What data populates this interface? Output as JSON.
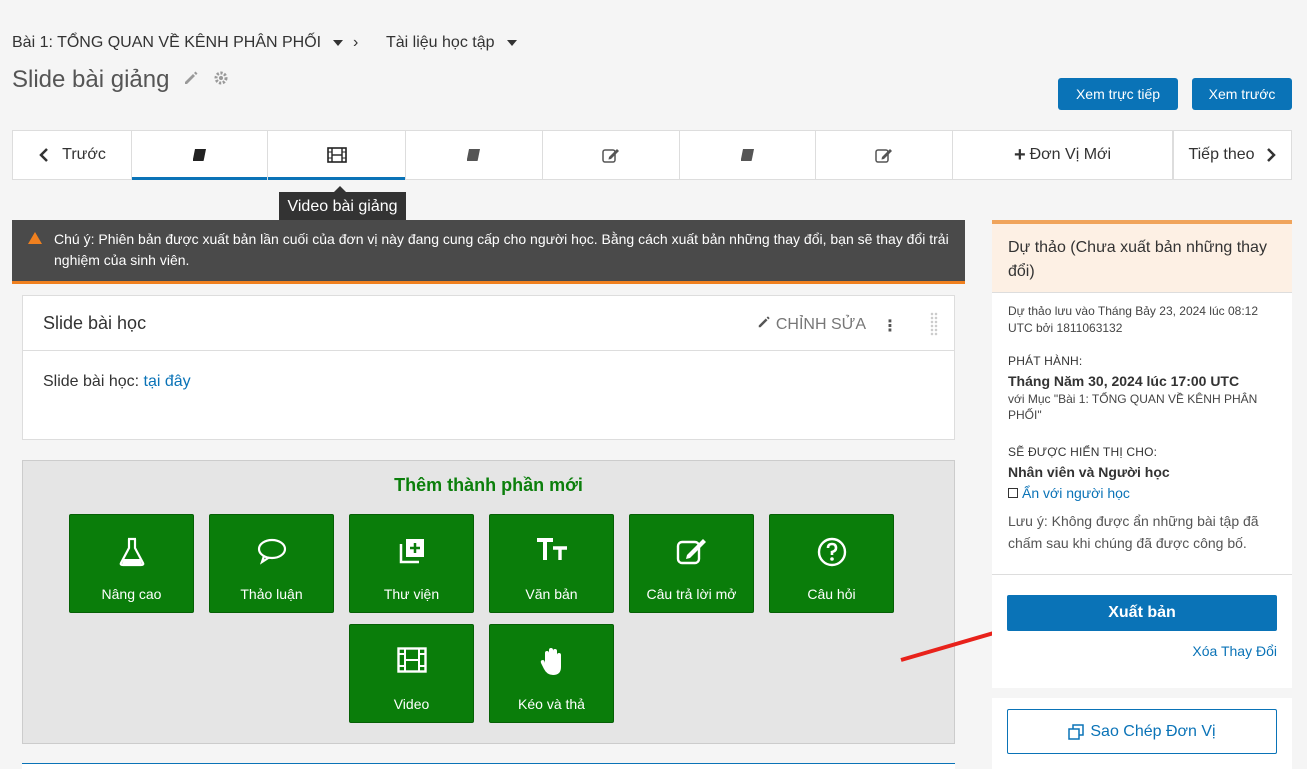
{
  "breadcrumb": {
    "section": "Bài 1: TỔNG QUAN VỀ KÊNH PHÂN PHỐI",
    "separator": "›",
    "subsection": "Tài liệu học tập"
  },
  "page": {
    "title": "Slide bài giảng"
  },
  "header_buttons": {
    "view_live": "Xem trực tiếp",
    "preview": "Xem trước"
  },
  "unit_nav": {
    "prev": "Trước",
    "new_unit": "Đơn Vị Mới",
    "next": "Tiếp theo",
    "units": [
      "book-icon",
      "film-icon",
      "book-icon",
      "edit-icon",
      "book-icon",
      "edit-icon"
    ],
    "tooltip": "Video bài giảng"
  },
  "warning": {
    "text": "Chú ý: Phiên bản được xuất bản lần cuối của đơn vị này đang cung cấp cho người học. Bằng cách xuất bản những thay đổi, bạn sẽ thay đổi trải nghiệm của sinh viên."
  },
  "component": {
    "title": "Slide bài học",
    "edit_label": "CHỈNH SỬA",
    "body_prefix": "Slide bài học: ",
    "body_link": "tại đây"
  },
  "add_component": {
    "title": "Thêm thành phần mới",
    "types": [
      "Nâng cao",
      "Thảo luận",
      "Thư viện",
      "Văn bản",
      "Câu trả lời mở",
      "Câu hỏi",
      "Video",
      "Kéo và thả"
    ]
  },
  "sidebar": {
    "status_title": "Dự thảo (Chưa xuất bản những thay đổi)",
    "draft_info": "Dự thảo lưu vào Tháng Bảy 23, 2024 lúc 08:12 UTC bởi 1811063132",
    "release_label": "PHÁT HÀNH:",
    "release_date": "Tháng Năm 30, 2024 lúc 17:00 UTC",
    "release_with": "với Mục \"Bài 1: TỔNG QUAN VỀ KÊNH PHÂN PHỐI\"",
    "visible_label": "SẼ ĐƯỢC HIỂN THỊ CHO:",
    "visible_to": "Nhân viên và Người học",
    "hide_label": "Ẩn với người học",
    "note": "Lưu ý: Không được ẩn những bài tập đã chấm sau khi chúng đã được công bố.",
    "publish": "Xuất bản",
    "discard": "Xóa Thay Đổi",
    "duplicate": "Sao Chép Đơn Vị"
  },
  "colors": {
    "accent": "#0a73b7",
    "add_green": "#0a7d0a",
    "warning_orange": "#f0801f"
  }
}
